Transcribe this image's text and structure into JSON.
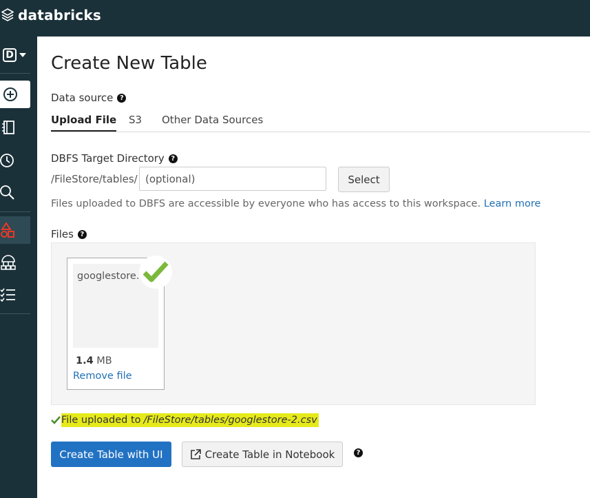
{
  "app": {
    "logo_text": "databricks"
  },
  "sidebar": {
    "workspace_initial": "D",
    "items": [
      {
        "icon": "plus-circle-icon"
      },
      {
        "icon": "notebook-icon"
      },
      {
        "icon": "clock-icon"
      },
      {
        "icon": "search-icon"
      },
      {
        "icon": "data-shapes-icon",
        "active": true
      },
      {
        "icon": "cluster-icon"
      },
      {
        "icon": "jobs-checklist-icon"
      }
    ]
  },
  "page": {
    "title": "Create New Table",
    "data_source_label": "Data source",
    "tabs": [
      {
        "label": "Upload File",
        "active": true
      },
      {
        "label": "S3"
      },
      {
        "label": "Other Data Sources"
      }
    ],
    "dbfs_label": "DBFS Target Directory",
    "path_prefix": "/FileStore/tables/",
    "dir_placeholder": "(optional)",
    "select_label": "Select",
    "note_text": "Files uploaded to DBFS are accessible by everyone who has access to this workspace.",
    "learn_more": "Learn more",
    "files_label": "Files",
    "file": {
      "name": "googlestore.csv",
      "size_value": "1.4",
      "size_unit": "MB",
      "remove_label": "Remove file"
    },
    "status": {
      "prefix": "File uploaded to",
      "path": "/FileStore/tables/googlestore-2.csv"
    },
    "create_ui_label": "Create Table with UI",
    "create_notebook_label": "Create Table in Notebook"
  },
  "colors": {
    "nav_bg": "#1b3139",
    "accent": "#2272c3",
    "active_icon": "#ff3621",
    "check": "#7ab93b",
    "highlight": "#e6ea1a"
  }
}
